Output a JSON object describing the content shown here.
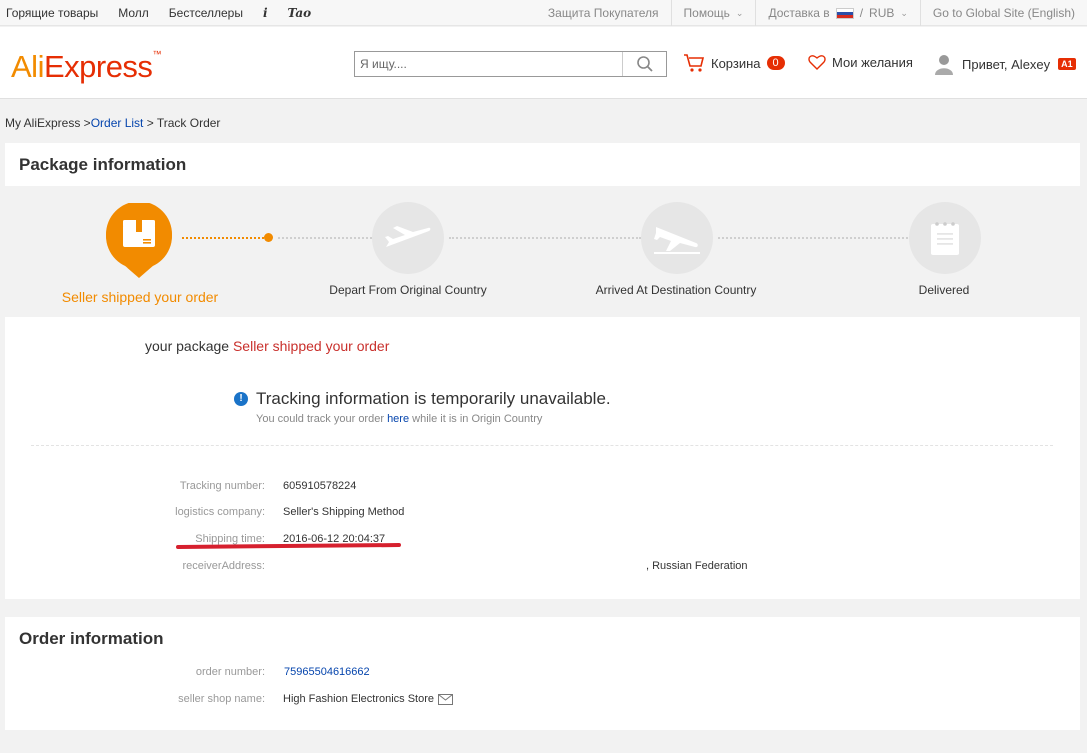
{
  "topbar": {
    "left_links": [
      "Горящие товары",
      "Молл",
      "Бестселлеры"
    ],
    "itao_logo": "iTao",
    "buyer_protection": "Защита Покупателя",
    "help": "Помощь",
    "delivery": "Доставка в",
    "currency": "RUB",
    "global_site": "Go to Global Site (English)"
  },
  "header": {
    "logo_text_ali": "Ali",
    "logo_text_express": "Express",
    "search_placeholder": "Я ищу....",
    "cart_label": "Корзина",
    "cart_count": "0",
    "wishlist_label": "Мои желания",
    "greeting": "Привет, Alexey",
    "user_badge": "A1"
  },
  "breadcrumb": {
    "root": "My AliExpress >",
    "order_list": "Order List",
    "current": " > Track Order"
  },
  "package": {
    "title": "Package information",
    "steps": [
      {
        "label": "Seller shipped your order",
        "icon": "box-icon",
        "active": true
      },
      {
        "label": "Depart From Original Country",
        "icon": "plane-takeoff-icon",
        "active": false
      },
      {
        "label": "Arrived At Destination Country",
        "icon": "plane-landing-icon",
        "active": false
      },
      {
        "label": "Delivered",
        "icon": "document-icon",
        "active": false
      }
    ],
    "status_prefix": "your package",
    "status_value": "Seller shipped your order",
    "unavailable_title": "Tracking information is temporarily unavailable.",
    "sub_prefix": "You could track your order",
    "sub_link": "here",
    "sub_suffix": "while it is in Origin Country",
    "details": [
      {
        "label": "Tracking number:",
        "value": "605910578224"
      },
      {
        "label": "logistics company:",
        "value": "Seller's Shipping Method"
      },
      {
        "label": "Shipping time:",
        "value": "2016-06-12 20:04:37"
      },
      {
        "label": "receiverAddress:",
        "value": ", Russian Federation"
      }
    ]
  },
  "order": {
    "title": "Order information",
    "order_number_label": "order number:",
    "order_number": "75965504616662",
    "shop_label": "seller shop name:",
    "shop_name": "High Fashion Electronics Store"
  },
  "colors": {
    "accent": "#f28b00",
    "brand_red": "#e62e04",
    "link": "#0645ad",
    "annotation": "#d6202e"
  }
}
